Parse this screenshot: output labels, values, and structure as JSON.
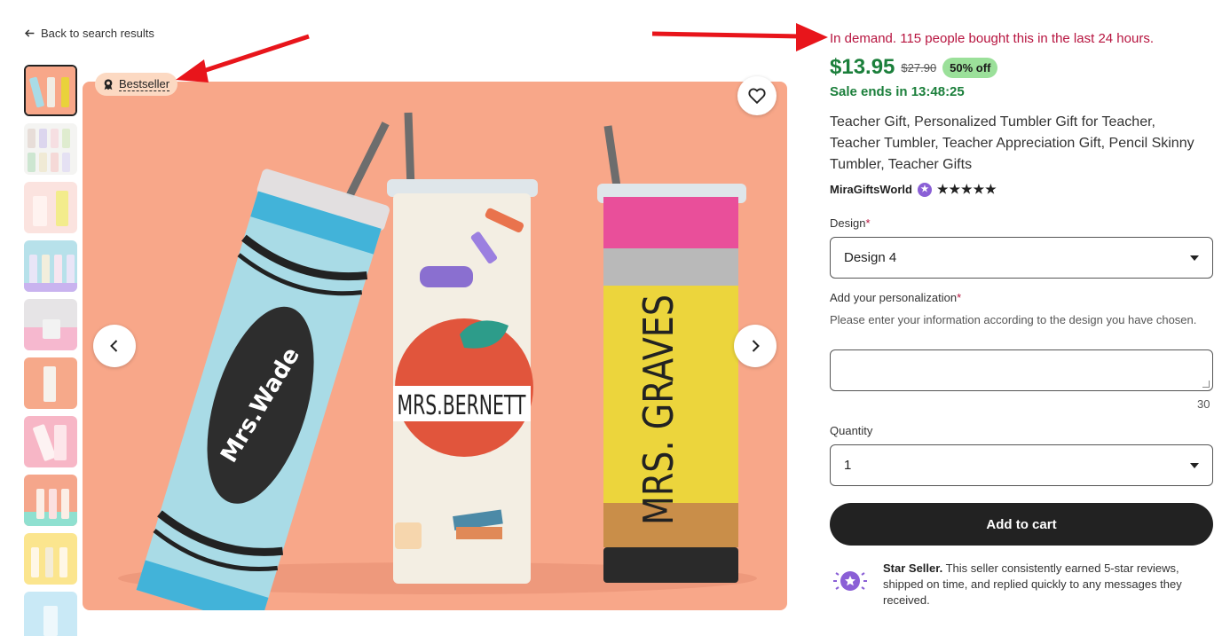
{
  "nav": {
    "back_label": "Back to search results"
  },
  "badge": {
    "label": "Bestseller"
  },
  "main_image": {
    "tumbler_texts": [
      "Mrs.Wade",
      "MRS.BERNETT",
      "MRS. GRAVES"
    ],
    "bg_color": "#f8a789"
  },
  "listing": {
    "demand_text": "In demand. 115 people bought this in the last 24 hours.",
    "price": "$13.95",
    "old_price": "$27.90",
    "discount": "50% off",
    "sale_ends": "Sale ends in 13:48:25",
    "title": "Teacher Gift, Personalized Tumbler Gift for Teacher, Teacher Tumbler, Teacher Appreciation Gift, Pencil Skinny Tumbler, Teacher Gifts",
    "seller": "MiraGiftsWorld",
    "stars": "★★★★★"
  },
  "form": {
    "design_label": "Design",
    "design_value": "Design 4",
    "personalization_label": "Add your personalization",
    "required_mark": "*",
    "personalization_help": "Please enter your information according to the design you have chosen.",
    "char_count": "30",
    "quantity_label": "Quantity",
    "quantity_value": "1",
    "add_to_cart": "Add to cart"
  },
  "star_seller": {
    "title": "Star Seller.",
    "text": " This seller consistently earned 5-star reviews, shipped on time, and replied quickly to any messages they received."
  },
  "colors": {
    "demand": "#b7143f",
    "price": "#1b7f3b",
    "discount_bg": "#9be09a",
    "cta_bg": "#222222",
    "annotation_arrow": "#e8151b"
  }
}
